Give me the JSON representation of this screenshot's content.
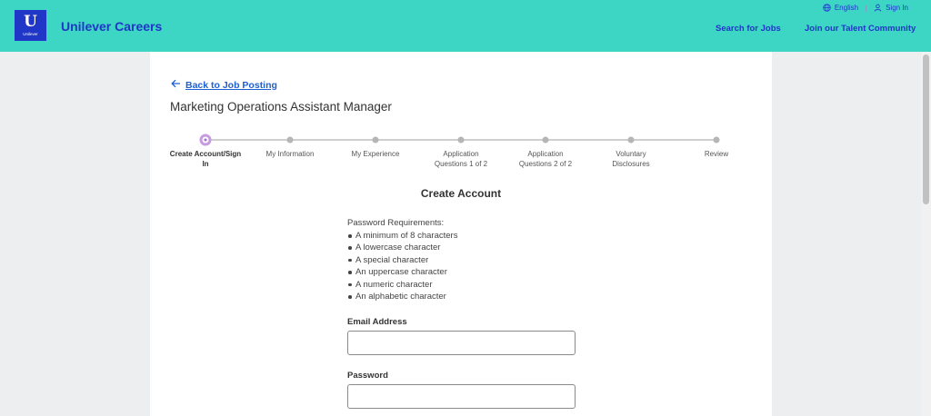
{
  "header": {
    "logo_text": "U",
    "logo_wordmark": "Unilever",
    "brand": "Unilever Careers",
    "language": "English",
    "signin": "Sign In",
    "nav": [
      "Search for Jobs",
      "Join our Talent Community"
    ]
  },
  "page": {
    "back_link": "Back to Job Posting",
    "job_title": "Marketing Operations Assistant Manager"
  },
  "stepper": {
    "active_index": 0,
    "steps": [
      "Create Account/Sign In",
      "My Information",
      "My Experience",
      "Application Questions 1 of 2",
      "Application Questions 2 of 2",
      "Voluntary Disclosures",
      "Review"
    ]
  },
  "form": {
    "title": "Create Account",
    "requirements_heading": "Password Requirements:",
    "requirements": [
      "A minimum of 8 characters",
      "A lowercase character",
      "A special character",
      "An uppercase character",
      "A numeric character",
      "An alphabetic character"
    ],
    "email_label": "Email Address",
    "email_value": "",
    "password_label": "Password",
    "password_value": ""
  },
  "colors": {
    "header_bg": "#3dd6c4",
    "brand_blue": "#1f36c7",
    "link_blue": "#1f5fcf",
    "active_step": "#c79be0"
  }
}
